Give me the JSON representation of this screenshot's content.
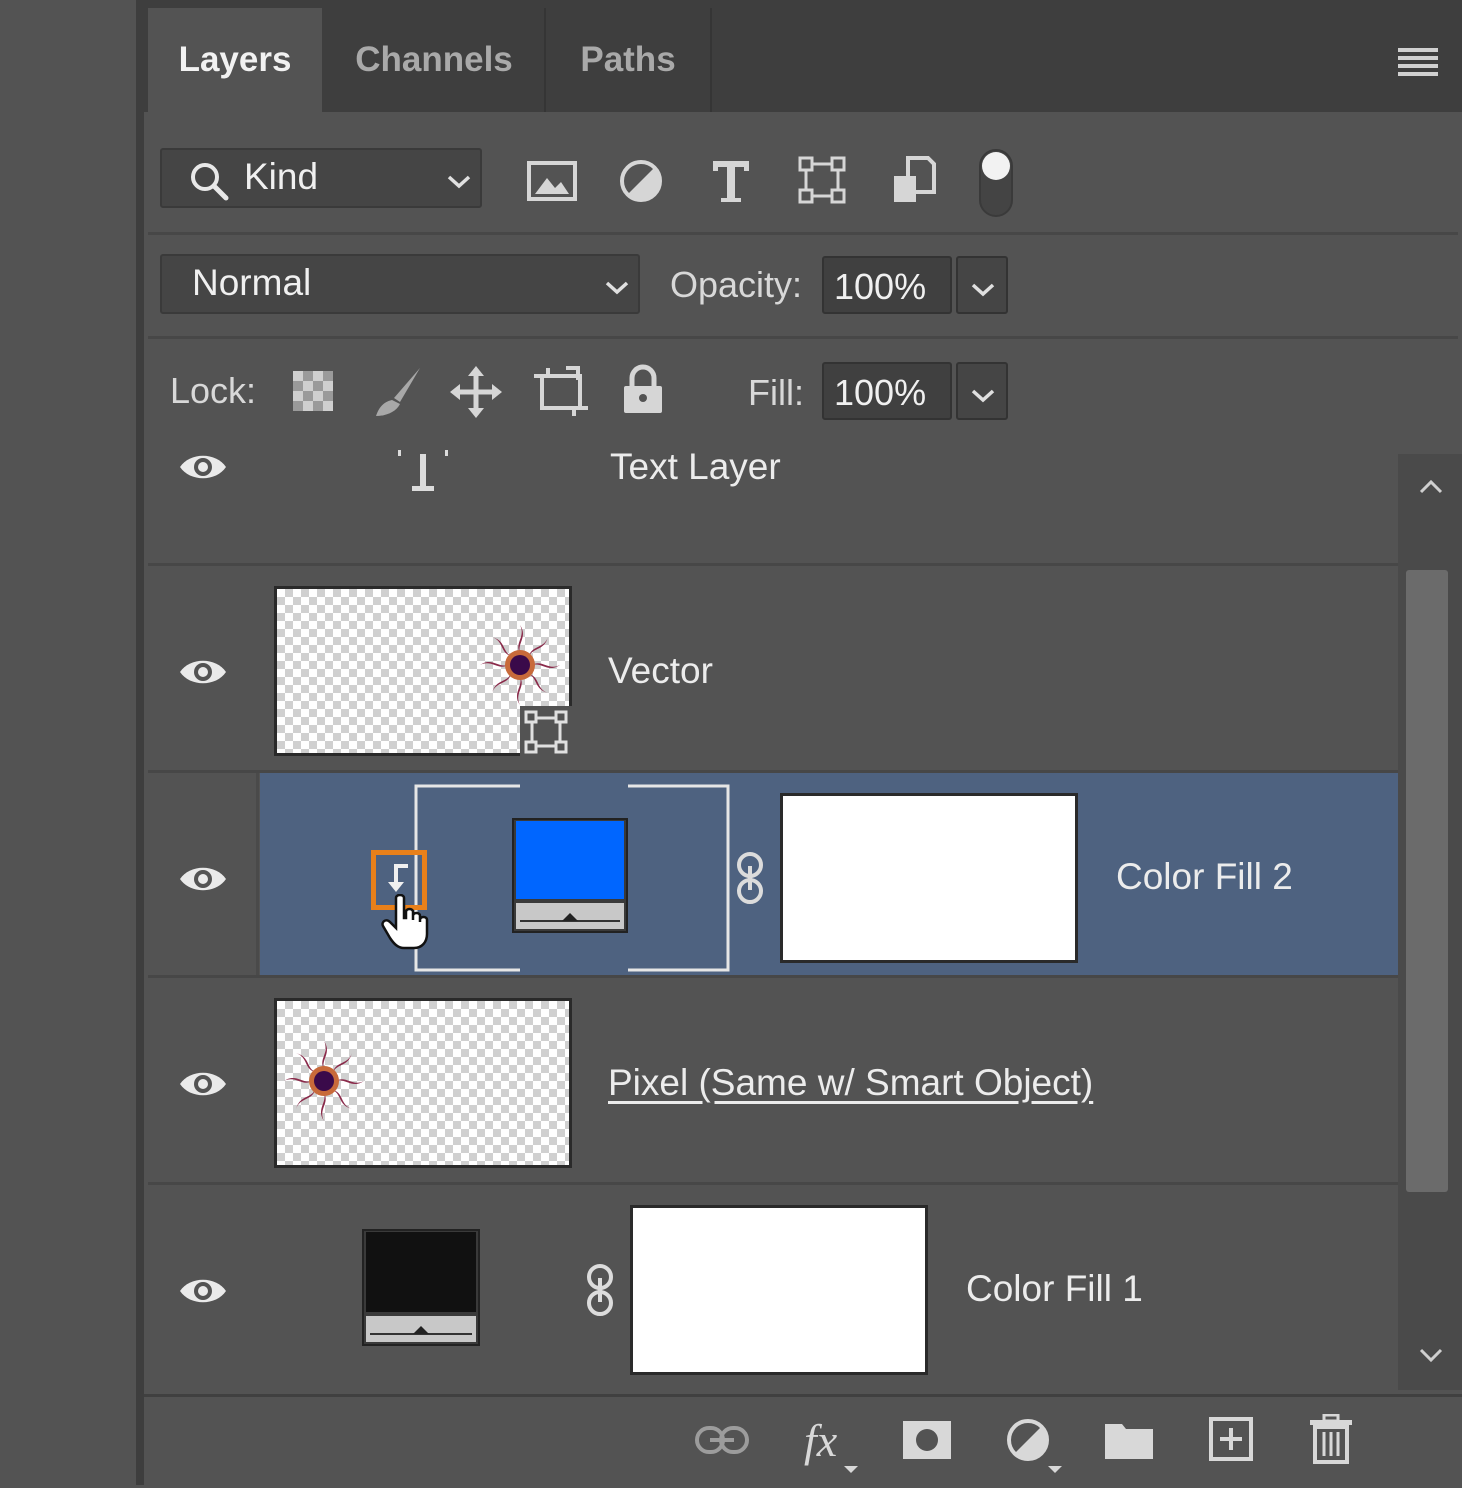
{
  "tabs": [
    {
      "label": "Layers",
      "active": true
    },
    {
      "label": "Channels",
      "active": false
    },
    {
      "label": "Paths",
      "active": false
    }
  ],
  "filter": {
    "kind_label": "Kind",
    "filter_icons": [
      "image-filter-icon",
      "adjustment-filter-icon",
      "type-filter-icon",
      "shape-filter-icon",
      "smart-object-filter-icon",
      "filter-toggle-icon"
    ]
  },
  "blend": {
    "mode": "Normal",
    "opacity_label": "Opacity:",
    "opacity_value": "100%"
  },
  "lock": {
    "label": "Lock:",
    "icons": [
      "lock-transparent-pixels-icon",
      "lock-image-pixels-icon",
      "lock-position-icon",
      "lock-artboard-icon",
      "lock-all-icon"
    ],
    "fill_label": "Fill:",
    "fill_value": "100%"
  },
  "layers": [
    {
      "name": "Text Layer",
      "kind": "text",
      "visible": true
    },
    {
      "name": "Vector",
      "kind": "shape",
      "visible": true
    },
    {
      "name": "Color Fill 2",
      "kind": "fill",
      "visible": true,
      "selected": true,
      "clipped": true,
      "fill_color": "#0066ff"
    },
    {
      "name": "Pixel (Same w/ Smart Object)",
      "kind": "pixel",
      "visible": true
    },
    {
      "name": "Color Fill 1",
      "kind": "fill",
      "visible": true,
      "fill_color": "#111111"
    }
  ],
  "footer_icons": [
    "link-layers-icon",
    "fx-icon",
    "add-mask-icon",
    "adjustment-layer-icon",
    "group-folder-icon",
    "new-layer-icon",
    "trash-icon"
  ],
  "colors": {
    "panel_bg": "#535353",
    "selected_row": "#4e6280",
    "highlight": "#e8801a"
  }
}
